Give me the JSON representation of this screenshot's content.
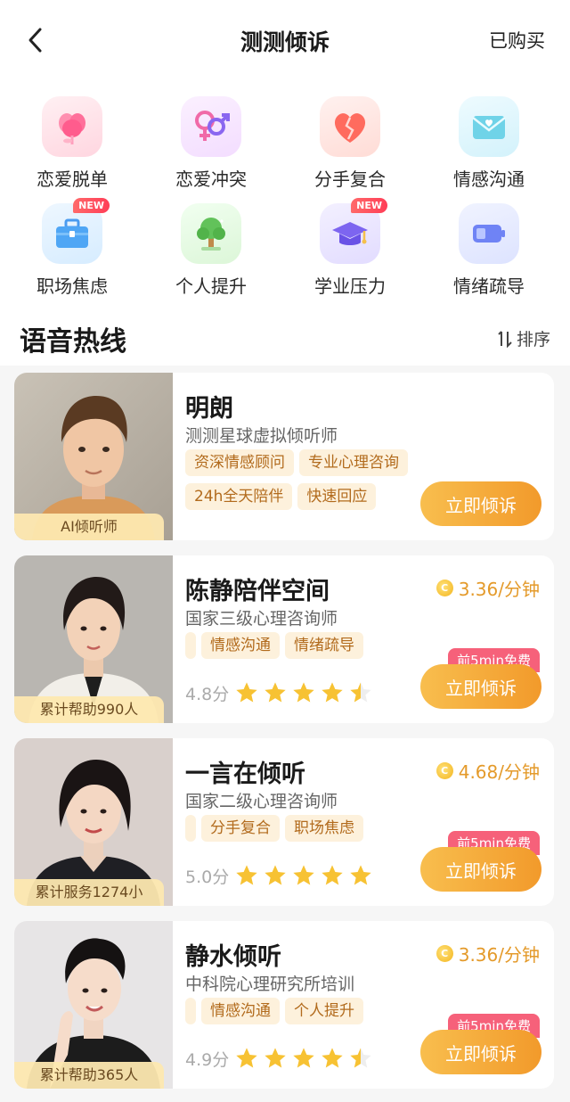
{
  "header": {
    "title": "测测倾诉",
    "purchased_label": "已购买"
  },
  "categories": [
    {
      "label": "恋爱脱单",
      "icon": "flower-heart-icon",
      "new": false
    },
    {
      "label": "恋爱冲突",
      "icon": "gender-symbols-icon",
      "new": false
    },
    {
      "label": "分手复合",
      "icon": "broken-heart-icon",
      "new": false
    },
    {
      "label": "情感沟通",
      "icon": "envelope-heart-icon",
      "new": false
    },
    {
      "label": "职场焦虑",
      "icon": "briefcase-icon",
      "new": true,
      "badge": "NEW"
    },
    {
      "label": "个人提升",
      "icon": "tree-icon",
      "new": false
    },
    {
      "label": "学业压力",
      "icon": "graduation-cap-icon",
      "new": true,
      "badge": "NEW"
    },
    {
      "label": "情绪疏导",
      "icon": "battery-icon",
      "new": false
    }
  ],
  "section": {
    "title": "语音热线",
    "sort_label": "排序"
  },
  "listeners": [
    {
      "name": "明朗",
      "subtitle": "测测星球虚拟倾听师",
      "tags": [
        "资深情感顾问",
        "专业心理咨询",
        "24h全天陪伴",
        "快速回应"
      ],
      "caption": "AI倾听师",
      "button": "立即倾诉"
    },
    {
      "name": "陈静陪伴空间",
      "subtitle": "国家三级心理咨询师",
      "tags": [
        "情感沟通",
        "情绪疏导"
      ],
      "caption": "累计帮助990人",
      "price": "3.36/分钟",
      "free_badge": "前5min免费",
      "score": "4.8分",
      "rating": 4.5,
      "button": "立即倾诉"
    },
    {
      "name": "一言在倾听",
      "subtitle": "国家二级心理咨询师",
      "tags": [
        "分手复合",
        "职场焦虑"
      ],
      "caption": "累计服务1274小",
      "price": "4.68/分钟",
      "free_badge": "前5min免费",
      "score": "5.0分",
      "rating": 5,
      "button": "立即倾诉"
    },
    {
      "name": "静水倾听",
      "subtitle": "中科院心理研究所培训",
      "tags": [
        "情感沟通",
        "个人提升"
      ],
      "caption": "累计帮助365人",
      "price": "3.36/分钟",
      "free_badge": "前5min免费",
      "score": "4.9分",
      "rating": 4.5,
      "button": "立即倾诉"
    }
  ],
  "colors": {
    "accent": "#f29a2b",
    "tag_bg": "#fdf1dc",
    "badge": "#f6617a",
    "star": "#f7c233"
  }
}
